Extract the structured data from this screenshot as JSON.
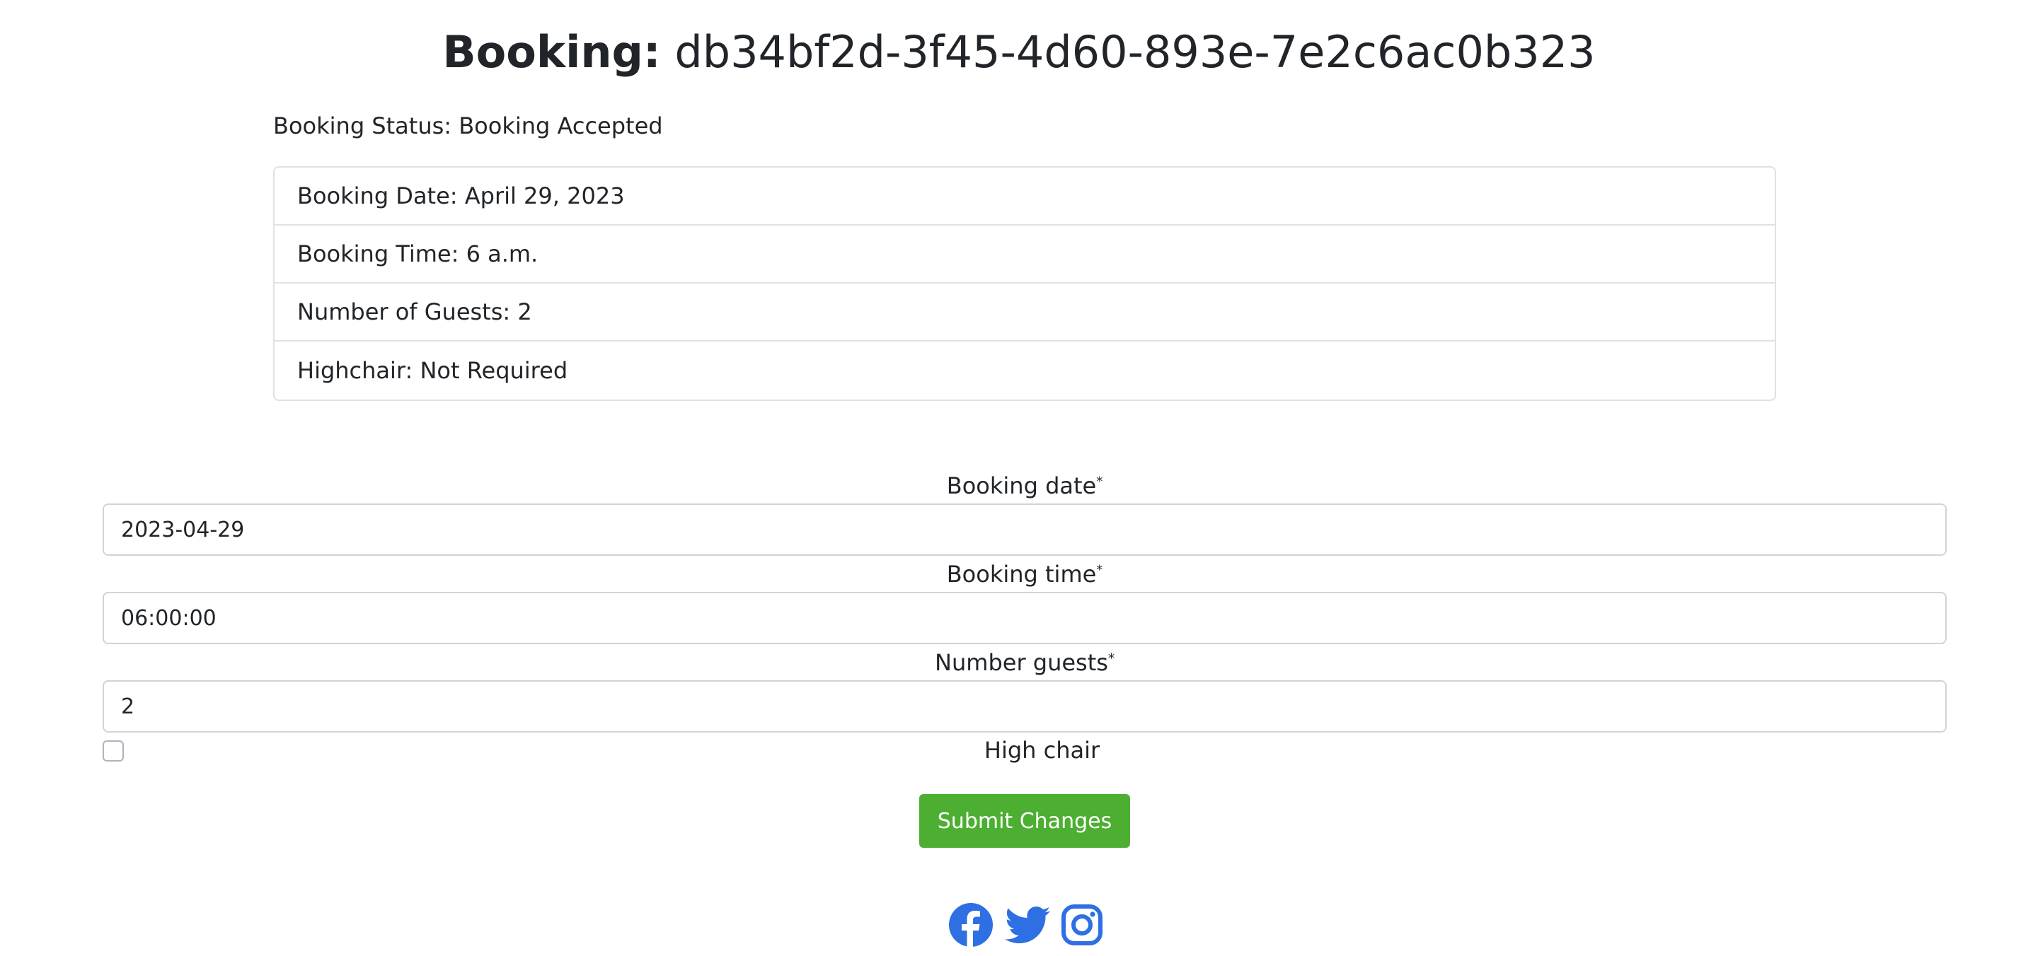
{
  "header": {
    "title_prefix": "Booking:",
    "booking_id": "db34bf2d-3f45-4d60-893e-7e2c6ac0b323"
  },
  "status": {
    "text": "Booking Status: Booking Accepted"
  },
  "details": [
    {
      "text": "Booking Date: April 29, 2023"
    },
    {
      "text": "Booking Time: 6 a.m."
    },
    {
      "text": "Number of Guests: 2"
    },
    {
      "text": "Highchair: Not Required"
    }
  ],
  "form": {
    "booking_date": {
      "label": "Booking date",
      "required_mark": "*",
      "value": "2023-04-29"
    },
    "booking_time": {
      "label": "Booking time",
      "required_mark": "*",
      "value": "06:00:00"
    },
    "number_guests": {
      "label": "Number guests",
      "required_mark": "*",
      "value": "2"
    },
    "high_chair": {
      "label": "High chair",
      "checked": false
    },
    "submit_label": "Submit Changes"
  },
  "social": {
    "icons": [
      "facebook-icon",
      "twitter-icon",
      "instagram-icon"
    ],
    "color": "#2f6fe4"
  },
  "colors": {
    "submit_bg": "#4caf32",
    "border": "#dee2e6"
  }
}
